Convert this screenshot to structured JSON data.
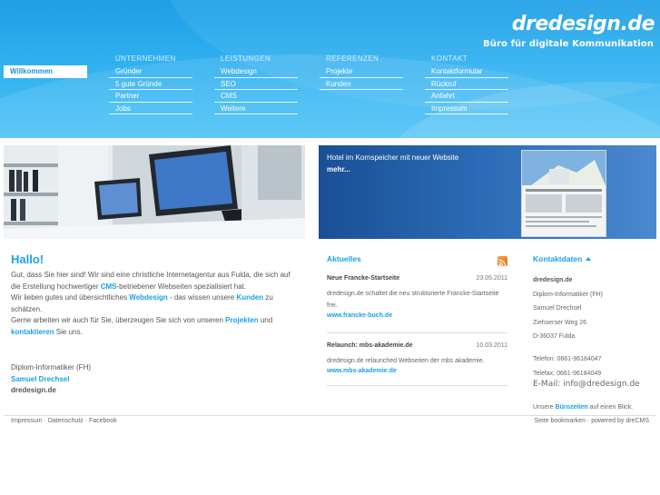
{
  "brand": {
    "logo": "dredesign.de",
    "tagline": "Büro für digitale Kommunikation"
  },
  "nav": {
    "welcome": "Willkommen",
    "columns": [
      {
        "heading": "UNTERNEHMEN",
        "items": [
          "Gründer",
          "5 gute Gründe",
          "Partner",
          "Jobs"
        ]
      },
      {
        "heading": "LEISTUNGEN",
        "items": [
          "Webdesign",
          "SEO",
          "CMS",
          "Weitere"
        ]
      },
      {
        "heading": "REFERENZEN",
        "items": [
          "Projekte",
          "Kunden"
        ]
      },
      {
        "heading": "KONTAKT",
        "items": [
          "Kontaktformular",
          "Rückruf",
          "Anfahrt",
          "Impressum"
        ]
      }
    ]
  },
  "banner": {
    "news_line": "Hotel im Kornspeicher mit neuer Website",
    "more": "mehr..."
  },
  "intro": {
    "heading": "Hallo!",
    "p1_a": "Gut, dass Sie hier sind! Wir sind eine christliche Internetagentur aus Fulda, die sich auf die Erstellung hochwertiger ",
    "p1_cms": "CMS",
    "p1_b": "-betriebener Webseiten spezialisiert hat.",
    "p2_a": "Wir lieben gutes und übersichtliches ",
    "p2_webdesign": "Webdesign",
    "p2_b": " - das wissen unsere ",
    "p2_kunden": "Kunden",
    "p2_c": " zu schätzen.",
    "p3_a": "Gerne arbeiten wir auch für Sie, überzeugen Sie sich von unseren ",
    "p3_projekten": "Projekten",
    "p3_b": " und ",
    "p3_kontaktieren": "kontaktieren",
    "p3_c": " Sie uns.",
    "sig_title": "Diplom-Informatiker (FH)",
    "sig_name": "Samuel Drechsel",
    "sig_company": "dredesign.de"
  },
  "news": {
    "heading": "Aktuelles",
    "items": [
      {
        "title": "Neue Francke-Startseite",
        "date": "23.05.2011",
        "body": "dredesign.de schaltet die neu strukturierte Francke-Startseite frei.",
        "link": "www.francke-buch.de"
      },
      {
        "title": "Relaunch: mbs-akademie.de",
        "date": "10.03.2011",
        "body": "dredesign.de relaunched Webseiten der mbs akademie.",
        "link": "www.mbs-akademie.de"
      }
    ]
  },
  "contact": {
    "heading": "Kontaktdaten",
    "company": "dredesign.de",
    "title": "Diplom-Informatiker (FH)",
    "name": "Samuel Drechsel",
    "street": "Ziehserser Weg 26",
    "city": "D-36037 Fulda",
    "phone": "Telefon: 0661-96184047",
    "fax": "Telefax: 0661-96184049",
    "email": "E-Mail: info@dredesign.de",
    "hours_a": "Unsere ",
    "hours_link": "Bürozeiten",
    "hours_b": " auf einen Blick."
  },
  "footer": {
    "left": "Impressum · Datenschutz · Facebook",
    "right": "Seite bookmarken · powered by dreCMS"
  }
}
